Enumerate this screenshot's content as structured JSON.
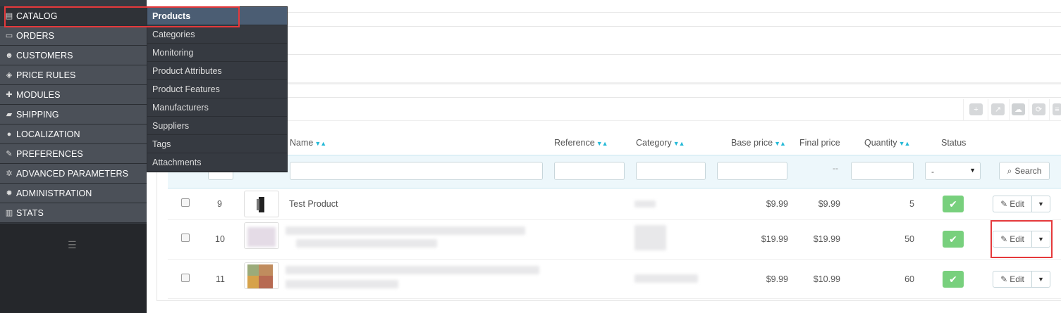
{
  "sidebar": {
    "items": [
      {
        "label": "CATALOG",
        "icon": "book-icon",
        "glyph": "▤"
      },
      {
        "label": "ORDERS",
        "icon": "credit-card-icon",
        "glyph": "▭"
      },
      {
        "label": "CUSTOMERS",
        "icon": "users-icon",
        "glyph": "☻"
      },
      {
        "label": "PRICE RULES",
        "icon": "tags-icon",
        "glyph": "◈"
      },
      {
        "label": "MODULES",
        "icon": "puzzle-icon",
        "glyph": "✚"
      },
      {
        "label": "SHIPPING",
        "icon": "truck-icon",
        "glyph": "▰"
      },
      {
        "label": "LOCALIZATION",
        "icon": "globe-icon",
        "glyph": "●"
      },
      {
        "label": "PREFERENCES",
        "icon": "wrench-icon",
        "glyph": "✎"
      },
      {
        "label": "ADVANCED PARAMETERS",
        "icon": "cogs-icon",
        "glyph": "✲"
      },
      {
        "label": "ADMINISTRATION",
        "icon": "cog-icon",
        "glyph": "✹"
      },
      {
        "label": "STATS",
        "icon": "bar-chart-icon",
        "glyph": "▥"
      }
    ],
    "toggle_glyph": "☰"
  },
  "submenu": {
    "items": [
      "Products",
      "Categories",
      "Monitoring",
      "Product Attributes",
      "Product Features",
      "Manufacturers",
      "Suppliers",
      "Tags",
      "Attachments"
    ]
  },
  "toolbar": {
    "icons": [
      "add-icon",
      "export-icon",
      "cloud-upload-icon",
      "refresh-icon",
      "database-icon"
    ]
  },
  "table": {
    "columns": {
      "name": "Name",
      "reference": "Reference",
      "category": "Category",
      "base_price": "Base price",
      "final_price": "Final price",
      "quantity": "Quantity",
      "status": "Status"
    },
    "sort_glyph": "▼▲",
    "filter": {
      "final_price_placeholder": "--",
      "status_select": "-",
      "search_label": "Search"
    },
    "rows": [
      {
        "id": "9",
        "name": "Test Product",
        "base_price": "$9.99",
        "final_price": "$9.99",
        "quantity": "5",
        "edit_label": "Edit"
      },
      {
        "id": "10",
        "name": "",
        "base_price": "$19.99",
        "final_price": "$19.99",
        "quantity": "50",
        "edit_label": "Edit"
      },
      {
        "id": "11",
        "name": "",
        "base_price": "$9.99",
        "final_price": "$10.99",
        "quantity": "60",
        "edit_label": "Edit"
      }
    ]
  },
  "colors": {
    "sidebar_bg": "#4b5058",
    "accent": "#25b9d7",
    "status_green": "#78d07d",
    "highlight_red": "#e5393b"
  }
}
